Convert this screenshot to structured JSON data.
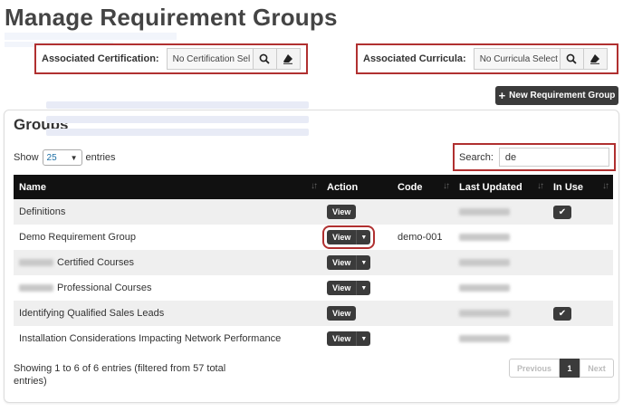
{
  "page": {
    "title": "Manage Requirement Groups"
  },
  "filters": {
    "certification": {
      "label": "Associated Certification:",
      "value": "No Certification Sel"
    },
    "curricula": {
      "label": "Associated Curricula:",
      "value": "No Curricula Select"
    }
  },
  "toolbar": {
    "new_group_label": "New Requirement Group"
  },
  "card": {
    "title": "Groups",
    "length": {
      "prefix": "Show",
      "value": "25",
      "suffix": "entries"
    },
    "search": {
      "label": "Search:",
      "value": "de"
    }
  },
  "table": {
    "columns": [
      "Name",
      "Action",
      "Code",
      "Last Updated",
      "In Use"
    ],
    "rows": [
      {
        "name": "Definitions",
        "action": "View",
        "has_dropdown": false,
        "code": "",
        "in_use": true
      },
      {
        "name": "Demo Requirement Group",
        "action": "View",
        "has_dropdown": true,
        "code": "demo-001",
        "in_use": false
      },
      {
        "name": "Certified Courses",
        "action": "View",
        "has_dropdown": true,
        "code": "",
        "in_use": false
      },
      {
        "name": "Professional Courses",
        "action": "View",
        "has_dropdown": true,
        "code": "",
        "in_use": false
      },
      {
        "name": "Identifying Qualified Sales Leads",
        "action": "View",
        "has_dropdown": false,
        "code": "",
        "in_use": true
      },
      {
        "name": "Installation Considerations Impacting Network Performance",
        "action": "View",
        "has_dropdown": true,
        "code": "",
        "in_use": false
      }
    ]
  },
  "footer": {
    "info": "Showing 1 to 6 of 6 entries (filtered from 57 total entries)",
    "pagination": {
      "previous": "Previous",
      "current": "1",
      "next": "Next"
    }
  },
  "colors": {
    "header_bg": "#111111",
    "highlight_border": "#b03030",
    "button_bg": "#3b3b3b"
  }
}
